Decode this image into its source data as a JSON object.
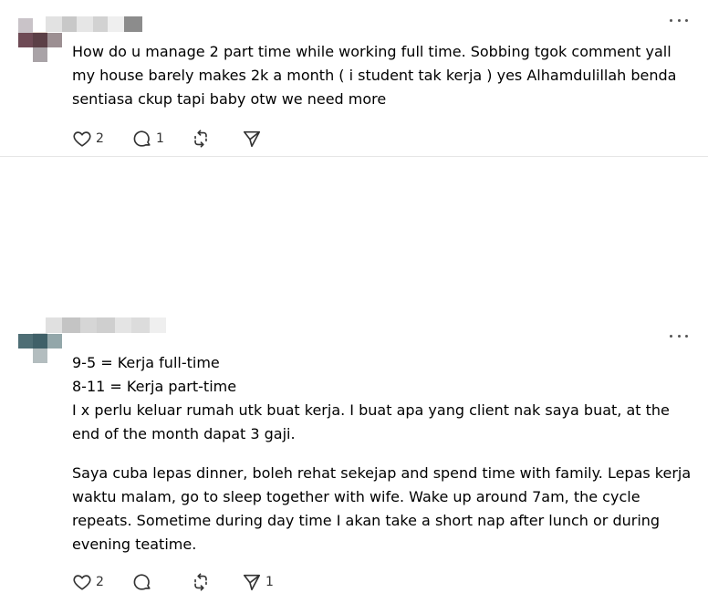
{
  "posts": [
    {
      "body": "How do u manage 2 part time while working full time. Sobbing tgok comment yall my house barely makes 2k a month ( i student tak kerja ) yes Alhamdulillah benda sentiasa ckup tapi baby otw we need more",
      "likes": "2",
      "replies": "1",
      "reposts": "",
      "shares": ""
    },
    {
      "lines": [
        "9-5 = Kerja full-time",
        "8-11 = Kerja part-time",
        "I x perlu keluar rumah utk buat kerja. I buat apa yang client nak saya buat, at the end of the month dapat 3 gaji."
      ],
      "paragraph": "Saya cuba lepas dinner, boleh rehat sekejap and spend time with family. Lepas kerja waktu malam, go to sleep together with wife. Wake up around 7am, the cycle repeats. Sometime during day time I akan take a short nap after lunch or during evening teatime.",
      "likes": "2",
      "replies": "",
      "reposts": "",
      "shares": "1"
    }
  ],
  "icons": {
    "more": "more-horizontal-icon",
    "like": "heart-icon",
    "reply": "comment-icon",
    "repost": "repost-icon",
    "share": "send-icon"
  },
  "colors": {
    "text": "#000000",
    "icon": "#333333",
    "divider": "#e6e6e6"
  }
}
